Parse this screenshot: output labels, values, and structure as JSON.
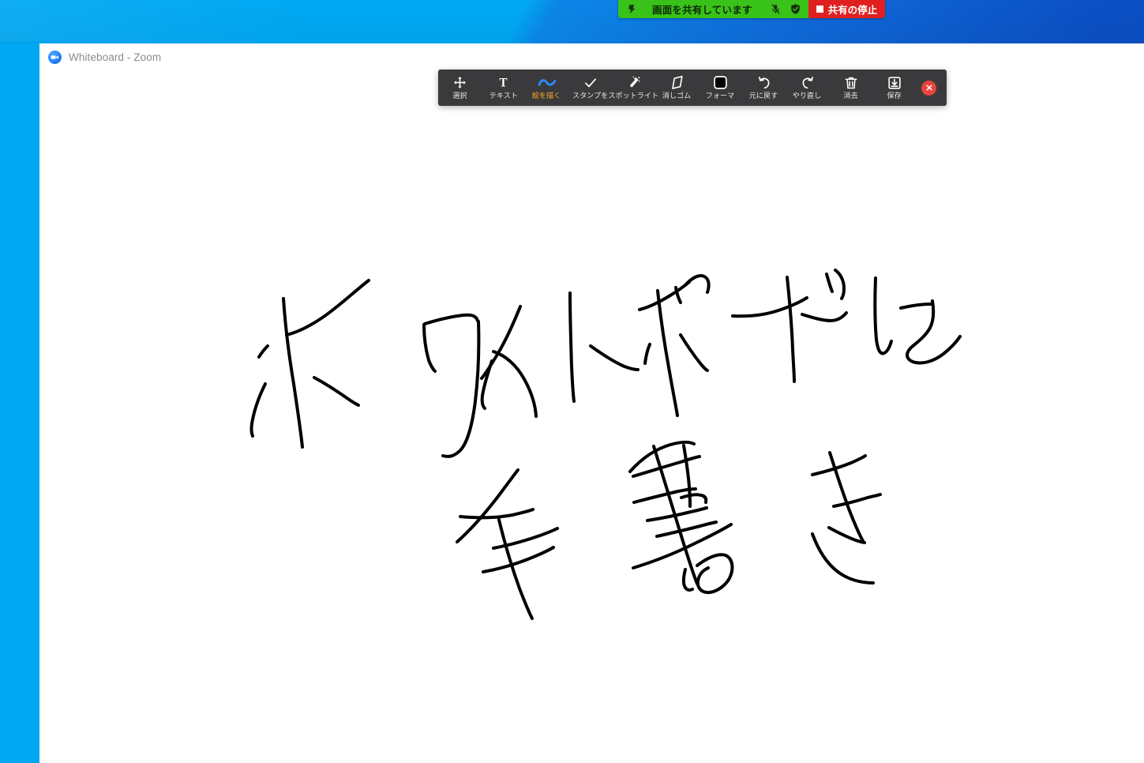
{
  "desktop": {
    "wallpaper_color_light": "#00a8f3",
    "wallpaper_color_dark": "#0a47bd"
  },
  "share_banner": {
    "pause_icon": "pause-share-icon",
    "status_text": "画面を共有しています",
    "mic_icon": "microphone-muted-icon",
    "security_icon": "shield-security-icon",
    "stop_label": "共有の停止",
    "green": "#39c219",
    "red": "#e02020"
  },
  "window": {
    "title": "Whiteboard - Zoom",
    "logo_icon": "zoom-camera-icon",
    "background": "#ffffff"
  },
  "toolbar": {
    "background": "#3a3a3c",
    "active_color": "#ffa726",
    "pen_color": "#2d8cff",
    "close_label": "×",
    "close_icon": "close-icon",
    "tools": [
      {
        "id": "select",
        "label": "選択",
        "icon": "move-arrows-icon",
        "active": false
      },
      {
        "id": "text",
        "label": "テキスト",
        "icon": "text-t-icon",
        "active": false
      },
      {
        "id": "draw",
        "label": "絵を描く",
        "icon": "pen-squiggle-icon",
        "active": true
      },
      {
        "id": "stamp",
        "label": "スタンプを",
        "icon": "checkmark-icon",
        "active": false
      },
      {
        "id": "spotlight",
        "label": "スポットライト",
        "icon": "magic-wand-icon",
        "active": false
      },
      {
        "id": "eraser",
        "label": "消しゴム",
        "icon": "eraser-icon",
        "active": false
      },
      {
        "id": "format",
        "label": "フォーマ",
        "icon": "filled-square-icon",
        "active": false
      },
      {
        "id": "undo",
        "label": "元に戻す",
        "icon": "undo-arrow-icon",
        "active": false
      },
      {
        "id": "redo",
        "label": "やり直し",
        "icon": "redo-arrow-icon",
        "active": false
      },
      {
        "id": "clear",
        "label": "消去",
        "icon": "trash-can-icon",
        "active": false
      },
      {
        "id": "save",
        "label": "保存",
        "icon": "save-download-icon",
        "active": false
      }
    ]
  },
  "canvas": {
    "ink_color": "#000000",
    "stroke_width": 4,
    "handwriting_text": "ホワイトボードに 手書き",
    "lines": [
      {
        "text": "ホワイトボードに"
      },
      {
        "text": "手書き"
      }
    ]
  }
}
